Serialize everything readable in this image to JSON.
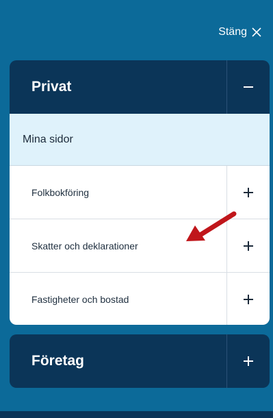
{
  "close": {
    "label": "Stäng",
    "icon": "close-icon"
  },
  "privat": {
    "title": "Privat",
    "toggle_icon": "minus-icon",
    "current_item": "Mina sidor",
    "items": [
      {
        "label": "Folkbokföring",
        "icon": "plus-icon"
      },
      {
        "label": "Skatter och deklarationer",
        "icon": "plus-icon"
      },
      {
        "label": "Fastigheter och bostad",
        "icon": "plus-icon"
      }
    ]
  },
  "foretag": {
    "title": "Företag",
    "toggle_icon": "plus-icon"
  },
  "annotation": {
    "icon": "red-arrow-icon",
    "color": "#c0161b"
  },
  "colors": {
    "background": "#0c6a99",
    "panel": "#0b3558",
    "highlight": "#dff2fb"
  }
}
